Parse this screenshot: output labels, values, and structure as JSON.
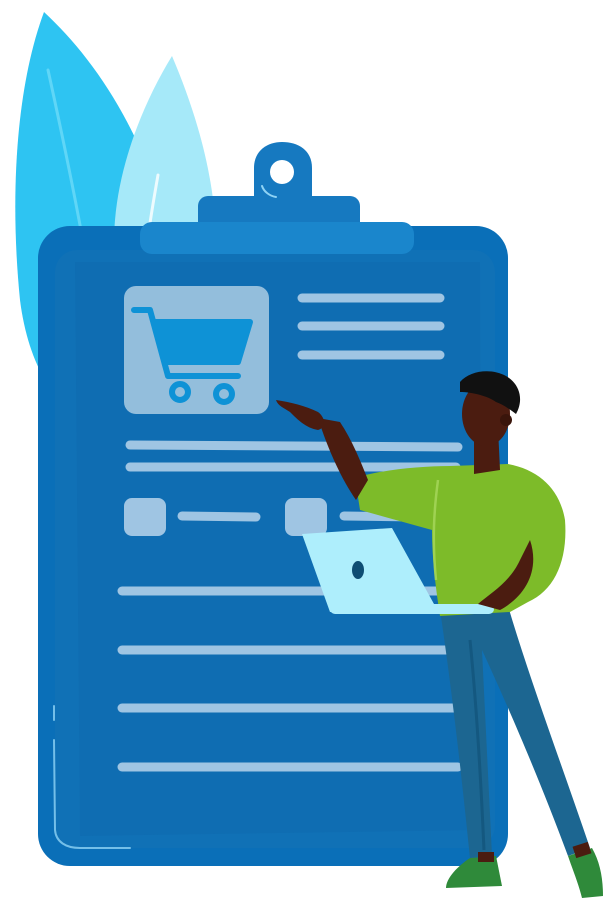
{
  "illustration": {
    "subject": "clipboard-shopping-checklist",
    "icons": [
      "leaf-icon",
      "clipboard-icon",
      "shopping-cart-icon",
      "laptop-icon"
    ],
    "colors": {
      "background": "#ffffff",
      "leaf_back": "#2ec4f2",
      "leaf_front": "#a6e9f9",
      "clipboard_edge": "#0a6fb8",
      "clipboard_board": "#1071b6",
      "clipboard_panel": "#0e5ea3",
      "clip": "#1679c0",
      "cart_card": "#93bedc",
      "cart_icon": "#0e92d6",
      "text_lines": "#9fc5e3",
      "shirt": "#7dbb29",
      "pants": "#1c6691",
      "skin": "#4b1c10",
      "hair": "#111111",
      "laptop": "#aeeefc",
      "shoes": "#2f8a3a"
    }
  }
}
